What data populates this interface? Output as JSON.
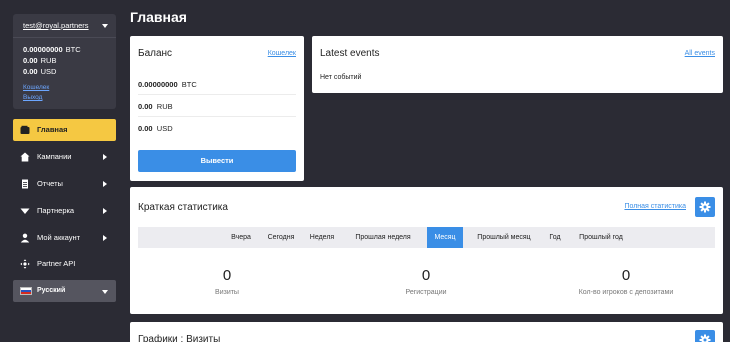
{
  "sidebar": {
    "account_email": "test@royal.partners",
    "balances": [
      {
        "amount": "0.00000000",
        "currency": "BTC"
      },
      {
        "amount": "0.00",
        "currency": "RUB"
      },
      {
        "amount": "0.00",
        "currency": "USD"
      }
    ],
    "wallet_link": "Кошелек",
    "logout_link": "Выход",
    "nav": [
      {
        "label": "Главная",
        "icon": "wallet-icon",
        "active": true
      },
      {
        "label": "Кампании",
        "icon": "home-icon"
      },
      {
        "label": "Отчеты",
        "icon": "report-icon"
      },
      {
        "label": "Партнерка",
        "icon": "down-triangle-icon"
      },
      {
        "label": "Мой аккаунт",
        "icon": "user-icon"
      },
      {
        "label": "Partner API",
        "icon": "api-icon"
      }
    ],
    "language": "Русский"
  },
  "main": {
    "title": "Главная",
    "balance": {
      "title": "Баланс",
      "wallet_link": "Кошелек",
      "rows": [
        {
          "amount": "0.00000000",
          "currency": "BTC"
        },
        {
          "amount": "0.00",
          "currency": "RUB"
        },
        {
          "amount": "0.00",
          "currency": "USD"
        }
      ],
      "withdraw_label": "Вывести"
    },
    "events": {
      "title": "Latest events",
      "all_link": "All events",
      "empty_text": "Нет событий"
    },
    "stats": {
      "title": "Краткая статистика",
      "full_link": "Полная статистика",
      "tabs": [
        "Вчера",
        "Сегодня",
        "Неделя",
        "Прошлая неделя",
        "Месяц",
        "Прошлый месяц",
        "Год",
        "Прошлый год"
      ],
      "active_tab": "Месяц",
      "items": [
        {
          "value": "0",
          "label": "Визиты"
        },
        {
          "value": "0",
          "label": "Регистрации"
        },
        {
          "value": "0",
          "label": "Кол-во игроков с депозитами"
        }
      ]
    },
    "graphs": {
      "title": "Графики : Визиты"
    }
  },
  "colors": {
    "accent": "#3a8ee6",
    "active_nav": "#f5c842",
    "sidebar_bg": "#2b2b34"
  }
}
